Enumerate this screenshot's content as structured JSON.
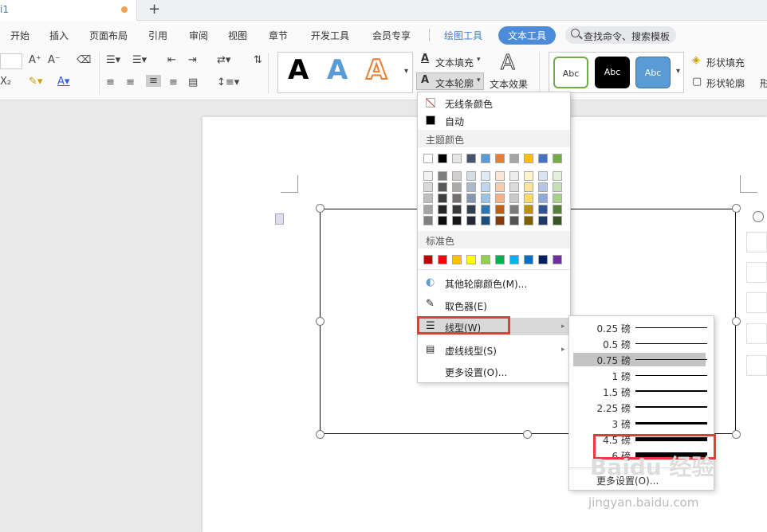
{
  "tabs": {
    "doc_title": "i1",
    "new_tab": "+"
  },
  "menu": {
    "items": [
      "开始",
      "插入",
      "页面布局",
      "引用",
      "审阅",
      "视图",
      "章节",
      "开发工具",
      "会员专享"
    ],
    "drawing_tools": "绘图工具",
    "text_tools": "文本工具",
    "search_placeholder": "查找命令、搜索模板"
  },
  "ribbon": {
    "text_fill": "文本填充",
    "text_outline": "文本轮廓",
    "text_effect": "文本效果",
    "shape_fill": "形状填充",
    "shape_outline": "形状轮廓",
    "shape_more": "形",
    "style_letter": "A",
    "shape_sample": "Abc"
  },
  "dropdown": {
    "no_line_color": "无线条颜色",
    "auto": "自动",
    "theme_colors_label": "主题颜色",
    "theme_top_row": [
      "#ffffff",
      "#000000",
      "#e7e6e6",
      "#44546a",
      "#5b9bd5",
      "#ed7d31",
      "#a5a5a5",
      "#ffc000",
      "#4472c4",
      "#70ad47"
    ],
    "theme_shades": [
      [
        "#f2f2f2",
        "#7f7f7f",
        "#d0cece",
        "#d6dce4",
        "#deebf6",
        "#fbe5d5",
        "#ededed",
        "#fff2cc",
        "#dae3f3",
        "#e2efd9"
      ],
      [
        "#d8d8d8",
        "#595959",
        "#aeaaaa",
        "#adb9ca",
        "#bdd7ee",
        "#f7cbac",
        "#dbdbdb",
        "#fee599",
        "#b4c6e7",
        "#c5e0b3"
      ],
      [
        "#bfbfbf",
        "#3f3f3f",
        "#757070",
        "#8496b0",
        "#9cc3e5",
        "#f4b183",
        "#c9c9c9",
        "#ffd965",
        "#8eaadb",
        "#a8d08d"
      ],
      [
        "#a5a5a5",
        "#262626",
        "#3a3838",
        "#323f4f",
        "#2e75b5",
        "#c55a11",
        "#7b7b7b",
        "#bf9000",
        "#2f5496",
        "#538135"
      ],
      [
        "#7f7f7f",
        "#0c0c0c",
        "#171616",
        "#222a35",
        "#1e4e79",
        "#833c0b",
        "#525252",
        "#7f6000",
        "#1f3864",
        "#375623"
      ]
    ],
    "standard_colors_label": "标准色",
    "standard_colors": [
      "#c00000",
      "#ff0000",
      "#ffc000",
      "#ffff00",
      "#92d050",
      "#00b050",
      "#00b0f0",
      "#0070c0",
      "#002060",
      "#7030a0"
    ],
    "other_outline_colors": "其他轮廓颜色(M)...",
    "eyedropper": "取色器(E)",
    "line_type": "线型(W)",
    "dash_type": "虚线线型(S)",
    "more_settings": "更多设置(O)..."
  },
  "submenu": {
    "items": [
      {
        "label": "0.25 磅",
        "weight": 0.25
      },
      {
        "label": "0.5 磅",
        "weight": 0.5
      },
      {
        "label": "0.75 磅",
        "weight": 0.75,
        "selected": true
      },
      {
        "label": "1 磅",
        "weight": 1
      },
      {
        "label": "1.5 磅",
        "weight": 1.5
      },
      {
        "label": "2.25 磅",
        "weight": 2.25
      },
      {
        "label": "3 磅",
        "weight": 3
      },
      {
        "label": "4.5 磅",
        "weight": 4.5
      },
      {
        "label": "6 磅",
        "weight": 6
      }
    ],
    "more": "更多设置(O)..."
  },
  "watermark": {
    "brand": "Baidu 经验",
    "url": "jingyan.baidu.com"
  }
}
